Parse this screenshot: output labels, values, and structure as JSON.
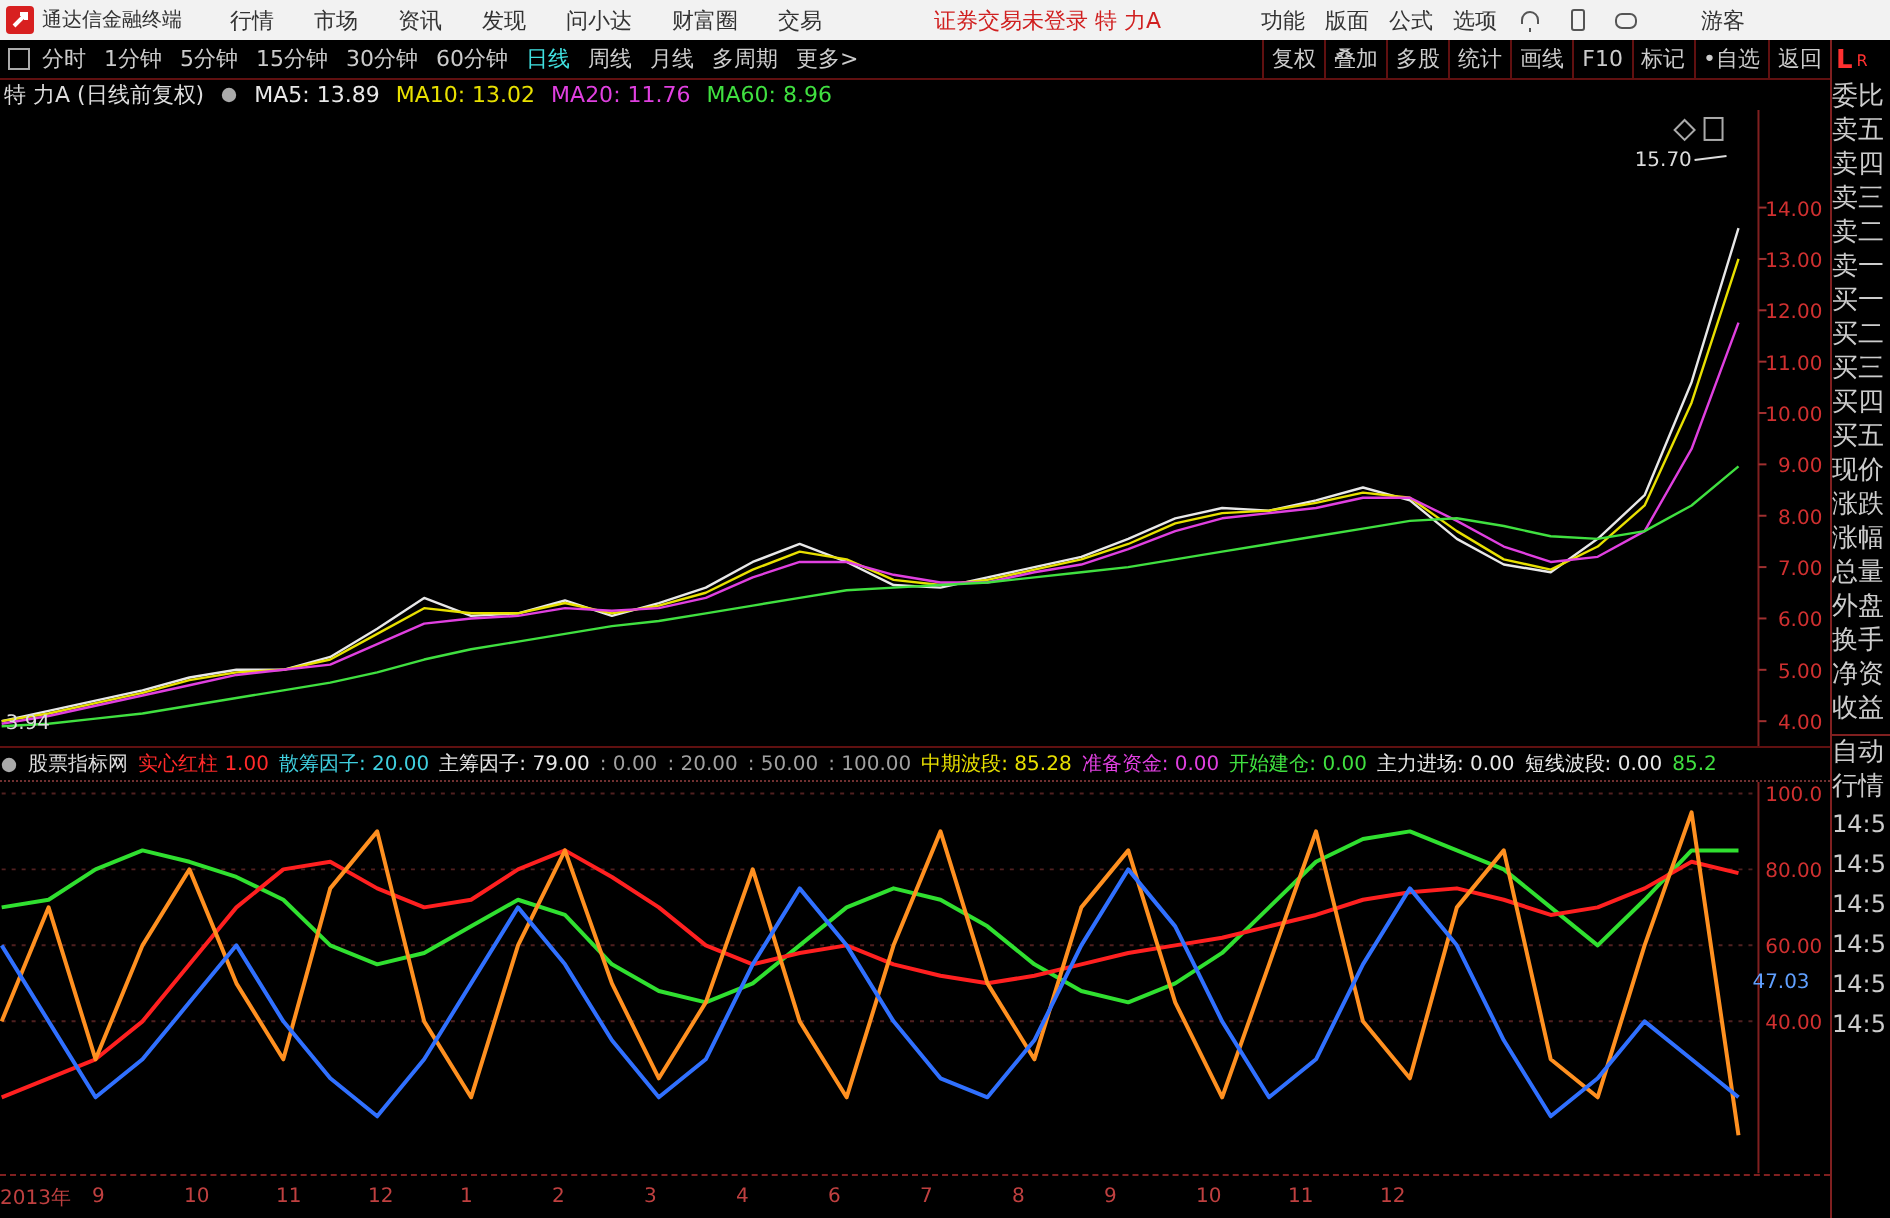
{
  "title_bar": {
    "app_name": "通达信金融终端",
    "menu": [
      "行情",
      "市场",
      "资讯",
      "发现",
      "问小达",
      "财富圈",
      "交易"
    ],
    "status": "证券交易未登录 特 力A",
    "right_menu": [
      "功能",
      "版面",
      "公式",
      "选项"
    ],
    "user": "游客"
  },
  "toolbar": {
    "periods": [
      {
        "label": "分时",
        "selected": false
      },
      {
        "label": "1分钟",
        "selected": false
      },
      {
        "label": "5分钟",
        "selected": false
      },
      {
        "label": "15分钟",
        "selected": false
      },
      {
        "label": "30分钟",
        "selected": false
      },
      {
        "label": "60分钟",
        "selected": false
      },
      {
        "label": "日线",
        "selected": true
      },
      {
        "label": "周线",
        "selected": false
      },
      {
        "label": "月线",
        "selected": false
      },
      {
        "label": "多周期",
        "selected": false
      },
      {
        "label": "更多>",
        "selected": false
      }
    ],
    "buttons": [
      "复权",
      "叠加",
      "多股",
      "统计",
      "画线",
      "F10",
      "标记",
      "•自选",
      "返回"
    ]
  },
  "price_panel": {
    "title": "特 力A (日线前复权)",
    "ma_values": [
      ": 13.89",
      ": 13.02",
      ": 11.76",
      ": 8.96"
    ],
    "high_label": "15.70",
    "low_label": "3.94",
    "chart_data": {
      "type": "line",
      "ylim": [
        3.5,
        15.9
      ],
      "yticks": [
        {
          "value": 4,
          "label": "4.00"
        },
        {
          "value": 5,
          "label": "5.00"
        },
        {
          "value": 6,
          "label": "6.00"
        },
        {
          "value": 7,
          "label": "7.00"
        },
        {
          "value": 8,
          "label": "8.00"
        },
        {
          "value": 9,
          "label": "9.00"
        },
        {
          "value": 10,
          "label": "10.00"
        },
        {
          "value": 11,
          "label": "11.00"
        },
        {
          "value": 12,
          "label": "12.00"
        },
        {
          "value": 13,
          "label": "13.00"
        },
        {
          "value": 14,
          "label": "14.00"
        }
      ],
      "series": [
        {
          "name": "MA5",
          "color": "#e8e8e8",
          "values": [
            4.0,
            4.2,
            4.4,
            4.6,
            4.85,
            5.0,
            5.0,
            5.25,
            5.8,
            6.4,
            6.05,
            6.1,
            6.35,
            6.05,
            6.3,
            6.6,
            7.1,
            7.45,
            7.1,
            6.65,
            6.6,
            6.8,
            7.0,
            7.2,
            7.55,
            7.95,
            8.15,
            8.1,
            8.3,
            8.55,
            8.3,
            7.55,
            7.05,
            6.9,
            7.55,
            8.4,
            10.6,
            13.6
          ]
        },
        {
          "name": "MA10",
          "color": "#e8e000",
          "values": [
            4.0,
            4.15,
            4.35,
            4.55,
            4.8,
            4.95,
            5.0,
            5.2,
            5.7,
            6.2,
            6.1,
            6.1,
            6.3,
            6.1,
            6.25,
            6.5,
            6.95,
            7.3,
            7.15,
            6.75,
            6.65,
            6.75,
            6.95,
            7.15,
            7.45,
            7.85,
            8.05,
            8.1,
            8.25,
            8.45,
            8.35,
            7.7,
            7.15,
            6.95,
            7.4,
            8.2,
            10.2,
            13.0
          ]
        },
        {
          "name": "MA20",
          "color": "#e040e0",
          "values": [
            3.95,
            4.1,
            4.3,
            4.5,
            4.7,
            4.9,
            5.0,
            5.1,
            5.5,
            5.9,
            6.0,
            6.05,
            6.2,
            6.15,
            6.2,
            6.4,
            6.8,
            7.1,
            7.1,
            6.85,
            6.7,
            6.7,
            6.9,
            7.05,
            7.35,
            7.7,
            7.95,
            8.05,
            8.15,
            8.35,
            8.35,
            7.9,
            7.4,
            7.1,
            7.2,
            7.7,
            9.3,
            11.76
          ]
        },
        {
          "name": "MA60",
          "color": "#40e040",
          "values": [
            3.9,
            3.95,
            4.05,
            4.15,
            4.3,
            4.45,
            4.6,
            4.75,
            4.95,
            5.2,
            5.4,
            5.55,
            5.7,
            5.85,
            5.95,
            6.1,
            6.25,
            6.4,
            6.55,
            6.6,
            6.65,
            6.7,
            6.8,
            6.9,
            7.0,
            7.15,
            7.3,
            7.45,
            7.6,
            7.75,
            7.9,
            7.95,
            7.8,
            7.6,
            7.55,
            7.7,
            8.2,
            8.96
          ]
        }
      ]
    }
  },
  "indicator_panel": {
    "source": "股票指标网",
    "items": [
      {
        "label": "实心红柱",
        "value": "1.00",
        "color": "#ff2a2a"
      },
      {
        "label": "散筹因子:",
        "value": "20.00",
        "color": "#40d0e0"
      },
      {
        "label": "主筹因子:",
        "value": "79.00",
        "color": "#e8e8e8"
      },
      {
        "value": ": 0.00",
        "color": "#a0a0a0"
      },
      {
        "value": ": 20.00",
        "color": "#a0a0a0"
      },
      {
        "value": ": 50.00",
        "color": "#a0a0a0"
      },
      {
        "value": ": 100.00",
        "color": "#a0a0a0"
      },
      {
        "label": "中期波段:",
        "value": "85.28",
        "color": "#e8e000"
      },
      {
        "label": "准备资金:",
        "value": "0.00",
        "color": "#e040e0"
      },
      {
        "label": "开始建仓:",
        "value": "0.00",
        "color": "#40e040"
      },
      {
        "label": "主力进场:",
        "value": "0.00",
        "color": "#e8e8e8"
      },
      {
        "label": "短线波段:",
        "value": "0.00",
        "color": "#e8e8e8"
      },
      {
        "value": "85.2",
        "color": "#40e040"
      }
    ],
    "current_label": "47.03",
    "chart_data": {
      "type": "line",
      "grid": true,
      "ylim": [
        0,
        103
      ],
      "yticks": [
        {
          "value": 40,
          "label": "40.00"
        },
        {
          "value": 60,
          "label": "60.00"
        },
        {
          "value": 80,
          "label": "80.00"
        },
        {
          "value": 100,
          "label": "100.0"
        }
      ],
      "series": [
        {
          "color": "#30e030",
          "values": [
            70,
            72,
            80,
            85,
            82,
            78,
            72,
            60,
            55,
            58,
            65,
            72,
            68,
            55,
            48,
            45,
            50,
            60,
            70,
            75,
            72,
            65,
            55,
            48,
            45,
            50,
            58,
            70,
            82,
            88,
            90,
            85,
            80,
            70,
            60,
            72,
            85,
            85
          ]
        },
        {
          "color": "#ff2020",
          "values": [
            20,
            25,
            30,
            40,
            55,
            70,
            80,
            82,
            75,
            70,
            72,
            80,
            85,
            78,
            70,
            60,
            55,
            58,
            60,
            55,
            52,
            50,
            52,
            55,
            58,
            60,
            62,
            65,
            68,
            72,
            74,
            75,
            72,
            68,
            70,
            75,
            82,
            79
          ]
        },
        {
          "color": "#ff9020",
          "values": [
            40,
            70,
            30,
            60,
            80,
            50,
            30,
            75,
            90,
            40,
            20,
            60,
            85,
            50,
            25,
            45,
            80,
            40,
            20,
            60,
            90,
            50,
            30,
            70,
            85,
            45,
            20,
            55,
            90,
            40,
            25,
            70,
            85,
            30,
            20,
            60,
            95,
            10
          ]
        },
        {
          "color": "#3070ff",
          "values": [
            60,
            40,
            20,
            30,
            45,
            60,
            40,
            25,
            15,
            30,
            50,
            70,
            55,
            35,
            20,
            30,
            55,
            75,
            60,
            40,
            25,
            20,
            35,
            60,
            80,
            65,
            40,
            20,
            30,
            55,
            75,
            60,
            35,
            15,
            25,
            40,
            30,
            20
          ]
        }
      ]
    }
  },
  "date_axis": [
    "2013年",
    "9",
    "10",
    "11",
    "12",
    "1",
    "2",
    "3",
    "4",
    "6",
    "7",
    "8",
    "9",
    "10",
    "11",
    "12"
  ],
  "side_panel": {
    "mark_left": "L",
    "mark_right": "R",
    "labels": [
      "委比",
      "卖五",
      "卖四",
      "卖三",
      "卖二",
      "卖一",
      "买一",
      "买二",
      "买三",
      "买四",
      "买五",
      "现价",
      "涨跌",
      "涨幅",
      "总量",
      "外盘",
      "换手",
      "净资",
      "收益"
    ],
    "tabs": [
      "自动",
      "行情"
    ],
    "times": [
      "14:5",
      "14:5",
      "14:5",
      "14:5",
      "14:5",
      "14:5"
    ]
  }
}
